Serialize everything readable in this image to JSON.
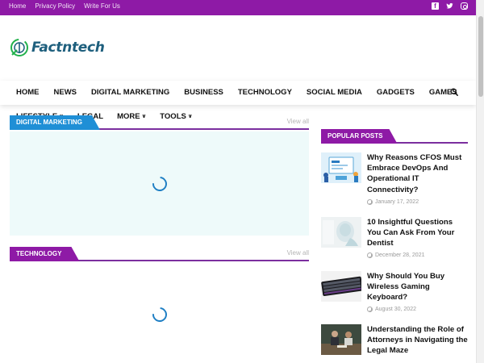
{
  "topbar": {
    "links": [
      "Home",
      "Privacy Policy",
      "Write For Us"
    ],
    "social_icons": [
      "facebook-icon",
      "twitter-icon",
      "instagram-icon"
    ]
  },
  "logo": {
    "text": "Factntech"
  },
  "nav": {
    "row1": [
      "HOME",
      "NEWS",
      "DIGITAL MARKETING",
      "BUSINESS",
      "TECHNOLOGY",
      "SOCIAL MEDIA",
      "GADGETS",
      "GAMES"
    ],
    "row2": [
      {
        "label": "LIFESTYLE",
        "dropdown": true
      },
      {
        "label": "LEGAL",
        "dropdown": false
      },
      {
        "label": "MORE",
        "dropdown": true
      },
      {
        "label": "TOOLS",
        "dropdown": true
      }
    ]
  },
  "sections": [
    {
      "label": "DIGITAL MARKETING",
      "view_all": "View all",
      "color": "#1f8fd6",
      "panel_bg": "#eefafa"
    },
    {
      "label": "TECHNOLOGY",
      "view_all": "View all",
      "color": "#8e1aa6",
      "panel_bg": "#ffffff"
    }
  ],
  "sidebar": {
    "heading": "POPULAR POSTS",
    "posts": [
      {
        "title": "Why Reasons CFOS Must Embrace DevOps And Operational IT Connectivity?",
        "date": "January 17, 2022"
      },
      {
        "title": "10 Insightful Questions You Can Ask From Your Dentist",
        "date": "December 28, 2021"
      },
      {
        "title": "Why Should You Buy Wireless Gaming Keyboard?",
        "date": "August 30, 2022"
      },
      {
        "title": "Understanding the Role of Attorneys in Navigating the Legal Maze",
        "date": ""
      }
    ]
  },
  "colors": {
    "brand_purple": "#8e1aa6",
    "accent_blue": "#1f8fd6",
    "logo_blue": "#1e5f7d",
    "logo_green": "#22b14c"
  }
}
